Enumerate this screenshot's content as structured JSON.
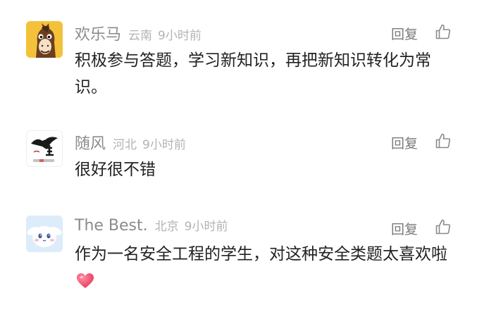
{
  "comments": [
    {
      "username": "欢乐马",
      "location": "云南",
      "time": "9小时前",
      "reply_label": "回复",
      "text": "积极参与答题，学习新知识，再把新知识转化为常识。",
      "avatar_icon": "horse-cartoon-avatar"
    },
    {
      "username": "随风",
      "location": "河北",
      "time": "9小时前",
      "reply_label": "回复",
      "text": "很好很不错",
      "avatar_icon": "eagle-calligraphy-avatar"
    },
    {
      "username": "The Best.",
      "location": "北京",
      "time": "9小时前",
      "reply_label": "回复",
      "text": "作为一名安全工程的学生，对这种安全类题太喜欢啦",
      "avatar_icon": "cinnamoroll-avatar",
      "emoji": "heart-emoji"
    }
  ],
  "colors": {
    "username": "#8b8b8b",
    "meta": "#b3b3b3",
    "body_text": "#222222",
    "heart": "#f0506e"
  }
}
